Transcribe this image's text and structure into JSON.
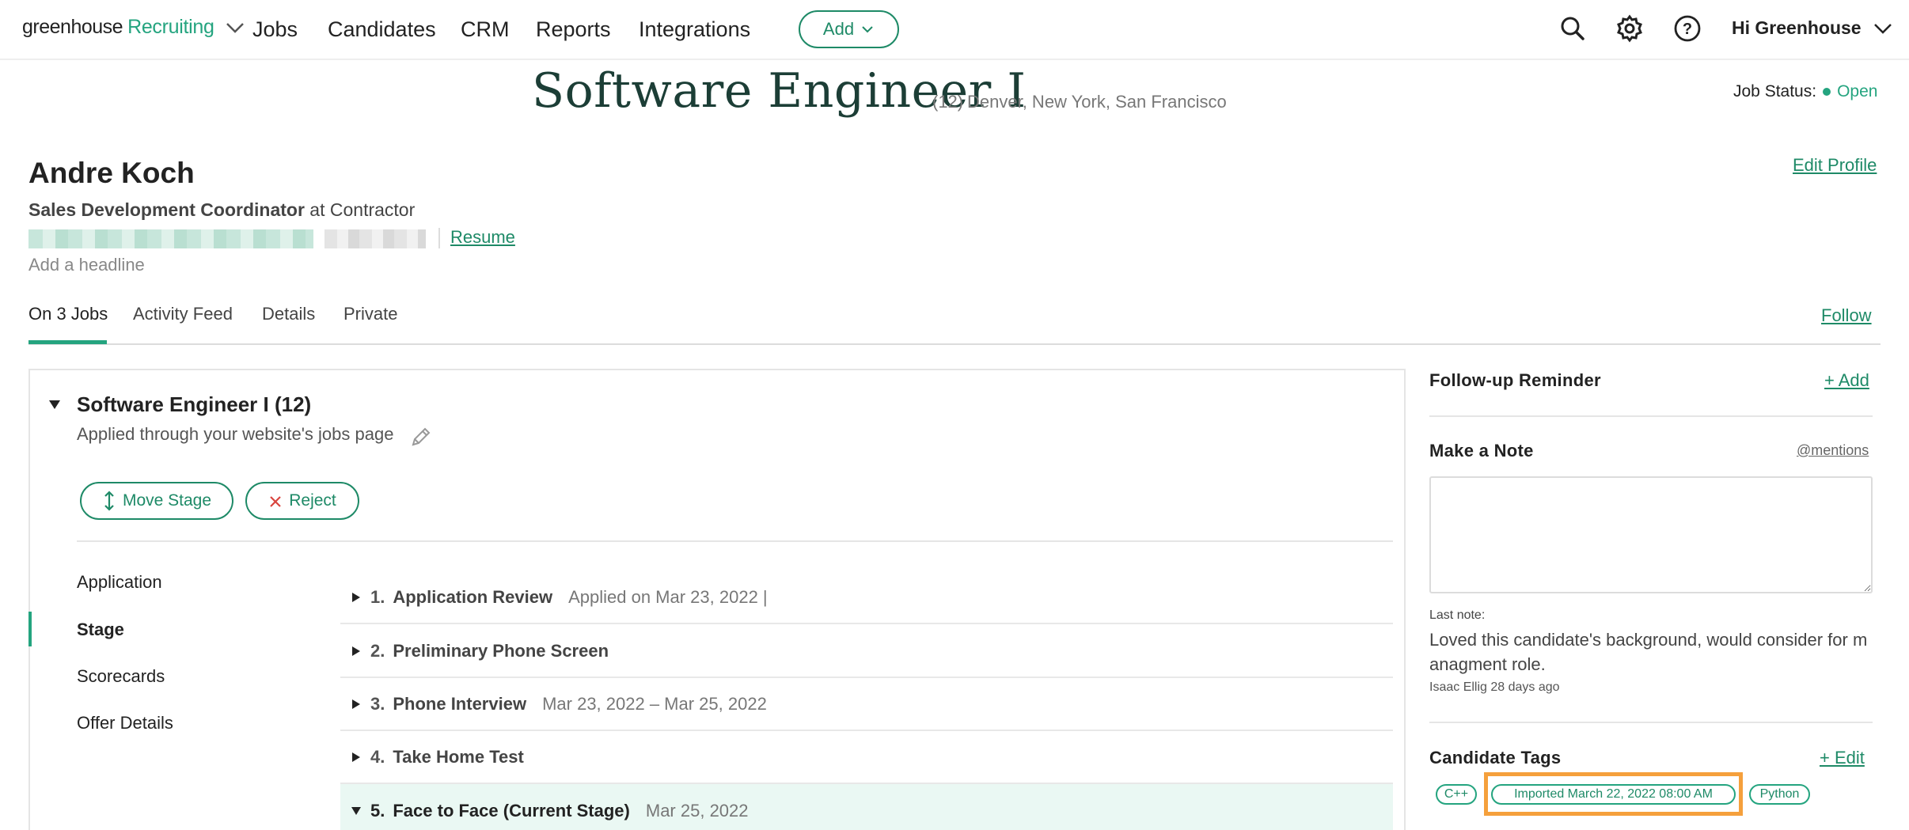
{
  "nav": {
    "brand_part1": "greenhouse",
    "brand_part2": "Recruiting",
    "links": [
      "Jobs",
      "Candidates",
      "CRM",
      "Reports",
      "Integrations"
    ],
    "add_label": "Add",
    "greeting": "Hi Greenhouse",
    "icons": [
      "search-icon",
      "gear-icon",
      "help-icon"
    ]
  },
  "job": {
    "title": "Software Engineer I",
    "count": "(12)",
    "locations": "Denver, New York, San Francisco",
    "status_label": "Job Status:",
    "status_value": "Open"
  },
  "candidate": {
    "name": "Andre Koch",
    "role": "Sales Development Coordinator",
    "company_connector": " at Contractor",
    "resume_label": "Resume",
    "headline_placeholder": "Add a headline",
    "edit_profile": "Edit Profile"
  },
  "tabs": [
    "On 3 Jobs",
    "Activity Feed",
    "Details",
    "Private"
  ],
  "follow_label": "Follow",
  "application": {
    "title": "Software Engineer I (12)",
    "source": "Applied through your website's jobs page",
    "move_stage": "Move Stage",
    "reject": "Reject",
    "side_nav": [
      "Application",
      "Stage",
      "Scorecards",
      "Offer Details"
    ],
    "stages": [
      {
        "num": "1.",
        "name": "Application Review",
        "date": "Applied on Mar 23, 2022 |"
      },
      {
        "num": "2.",
        "name": "Preliminary Phone Screen",
        "date": ""
      },
      {
        "num": "3.",
        "name": "Phone Interview",
        "date": "Mar 23, 2022 – Mar 25, 2022"
      },
      {
        "num": "4.",
        "name": "Take Home Test",
        "date": ""
      },
      {
        "num": "5.",
        "name": "Face to Face (Current Stage)",
        "date": "Mar 25, 2022"
      }
    ]
  },
  "sidebar": {
    "reminder_title": "Follow-up Reminder",
    "reminder_add": "+ Add",
    "note_title": "Make a Note",
    "mentions": "@mentions",
    "last_note_label": "Last note:",
    "last_note_text": "Loved this candidate's background, would consider for managment role.",
    "last_note_meta": "Isaac Ellig 28 days ago",
    "tags_title": "Candidate Tags",
    "tags_edit": "+ Edit",
    "tags": [
      "C++",
      "Imported March 22, 2022 08:00 AM",
      "Python"
    ]
  },
  "colors": {
    "brand_green": "#24a47f",
    "link_green": "#1e8a67",
    "highlight_orange": "#f5a03c",
    "current_stage_bg": "#eaf8f3"
  }
}
